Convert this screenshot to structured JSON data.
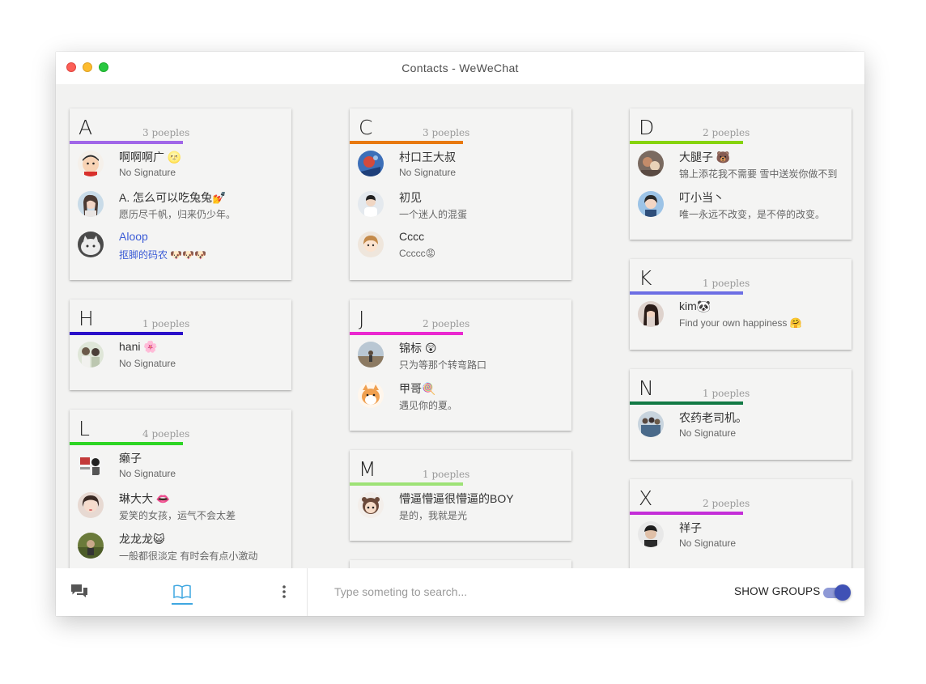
{
  "window": {
    "title": "Contacts - WeWeChat"
  },
  "colors": {
    "accent": "#3f51b5",
    "tab_underline": "#3fa7e1"
  },
  "groups": {
    "A": {
      "letter": "A",
      "count": "3 poeples",
      "color": "#a066e8",
      "contacts": [
        {
          "name": "啊啊啊广 🌝",
          "signature": "No Signature",
          "avatar": "crayon-shin-chan"
        },
        {
          "name": "A. 怎么可以吃兔兔💅",
          "signature": "愿历尽千帆，归来仍少年。",
          "avatar": "girl-portrait"
        },
        {
          "name": "Aloop",
          "signature": "抠脚的码农 🐶🐶🐶",
          "avatar": "cat-photo"
        }
      ]
    },
    "C": {
      "letter": "C",
      "count": "3 poeples",
      "color": "#e8790f",
      "contacts": [
        {
          "name": "村口王大叔",
          "signature": "No Signature",
          "avatar": "blue-art"
        },
        {
          "name": "初见",
          "signature": "一个迷人的混蛋",
          "avatar": "boy-photo"
        },
        {
          "name": "Cccc",
          "signature": "Ccccc😡",
          "avatar": "cartoon-girl"
        }
      ]
    },
    "D": {
      "letter": "D",
      "count": "2 poeples",
      "color": "#86d30b",
      "contacts": [
        {
          "name": "大腿子 🐻",
          "signature": "锦上添花我不需要 雪中送炭你做不到",
          "avatar": "food-photo"
        },
        {
          "name": "叮小当丶",
          "signature": "唯一永远不改变，是不停的改变。",
          "avatar": "girl-blue"
        }
      ]
    },
    "H": {
      "letter": "H",
      "count": "1 poeples",
      "color": "#2a0fc9",
      "contacts": [
        {
          "name": "hani 🌸",
          "signature": "No Signature",
          "avatar": "couple-photo"
        }
      ]
    },
    "J": {
      "letter": "J",
      "count": "2 poeples",
      "color": "#ea28d0",
      "contacts": [
        {
          "name": "锦标 😲",
          "signature": "只为等那个转弯路口",
          "avatar": "landscape"
        },
        {
          "name": "甲哥🍭",
          "signature": "遇见你的夏。",
          "avatar": "shiba-cartoon"
        }
      ]
    },
    "K": {
      "letter": "K",
      "count": "1 poeples",
      "color": "#6c6ee4",
      "contacts": [
        {
          "name": "kim🐼",
          "signature": "Find your own happiness 🤗",
          "avatar": "girl-dark"
        }
      ]
    },
    "L": {
      "letter": "L",
      "count": "4 poeples",
      "color": "#2dd524",
      "contacts": [
        {
          "name": "癞子",
          "signature": "No Signature",
          "avatar": "comic"
        },
        {
          "name": "琳大大 👄",
          "signature": "爱笑的女孩，运气不会太差",
          "avatar": "girl-face"
        },
        {
          "name": "龙龙龙😺",
          "signature": "一般都很淡定 有时会有点小激动",
          "avatar": "green-field"
        }
      ]
    },
    "M": {
      "letter": "M",
      "count": "1 poeples",
      "color": "#9de276",
      "contacts": [
        {
          "name": "懵逼懵逼很懵逼的BOY",
          "signature": "是的，我就是光",
          "avatar": "cartoon-bear"
        }
      ]
    },
    "N": {
      "letter": "N",
      "count": "1 poeples",
      "color": "#127a45",
      "contacts": [
        {
          "name": "农药老司机。",
          "signature": "No Signature",
          "avatar": "group-photo"
        }
      ]
    },
    "X": {
      "letter": "X",
      "count": "2 poeples",
      "color": "#c42ed8",
      "contacts": [
        {
          "name": "祥子",
          "signature": "No Signature",
          "avatar": "man-selfie"
        }
      ]
    }
  },
  "bottom": {
    "search_placeholder": "Type someting to search...",
    "show_groups_label": "SHOW GROUPS",
    "show_groups_on": true,
    "nav": [
      "chat-icon",
      "contacts-book-icon",
      "more-vertical-icon"
    ]
  }
}
